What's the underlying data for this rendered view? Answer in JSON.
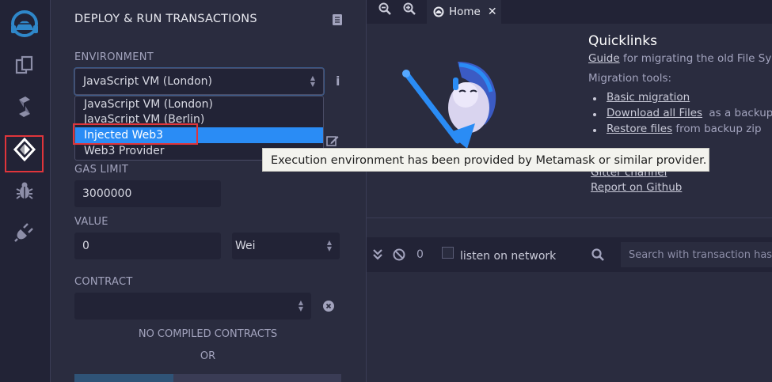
{
  "iconbar": {
    "items": [
      {
        "name": "remix-logo-icon"
      },
      {
        "name": "file-explorers-icon"
      },
      {
        "name": "solidity-compiler-icon"
      },
      {
        "name": "deploy-run-icon",
        "active": true
      },
      {
        "name": "debugger-icon"
      },
      {
        "name": "plugin-manager-icon"
      }
    ]
  },
  "panel": {
    "title": "DEPLOY & RUN TRANSACTIONS",
    "environment_label": "ENVIRONMENT",
    "environment_value": "JavaScript VM (London)",
    "environment_options": [
      "JavaScript VM (London)",
      "JavaScript VM (Berlin)",
      "Injected Web3",
      "Web3 Provider"
    ],
    "selected_option": "Injected Web3",
    "gas_limit_label": "GAS LIMIT",
    "gas_limit_value": "3000000",
    "value_label": "VALUE",
    "value_value": "0",
    "value_unit": "Wei",
    "contract_label": "CONTRACT",
    "no_contracts": "NO COMPILED CONTRACTS",
    "or": "OR"
  },
  "tooltip": "Execution environment has been provided by Metamask or similar provider.",
  "tabs": {
    "home_label": "Home"
  },
  "home": {
    "quicklinks_title": "Quicklinks",
    "guide_link": "Guide",
    "guide_text": "for migrating the old File System",
    "migration_tools": "Migration tools:",
    "basic_migration": "Basic migration",
    "download_all": "Download all Files",
    "download_suffix": "as a backup zip",
    "restore_files": "Restore files",
    "restore_suffix": "from backup zip",
    "gitter": "Gitter channel",
    "report": "Report on Github"
  },
  "terminal": {
    "count": "0",
    "listen_label": "listen on network",
    "search_placeholder": "Search with transaction hash or address"
  },
  "colors": {
    "accent": "#2a8cf5",
    "highlight_box": "#e0353b",
    "logo": "#2f87c9"
  }
}
